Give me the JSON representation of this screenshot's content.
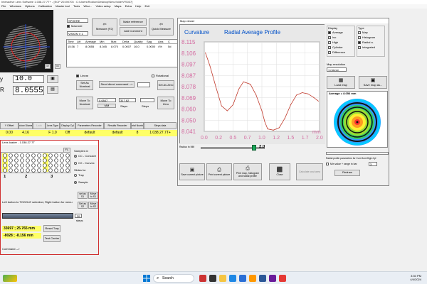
{
  "app": {
    "title": "Interactive Lens Software 1.038.27.7T+ - [ECP 20190703 : C:\\Users\\Rodion\\Desktop\\New folder\\FS037]",
    "menu": [
      "File",
      "Windows",
      "Options",
      "Calibration",
      "Master tool",
      "Tools",
      "Wizz...",
      "Video setup",
      "Maps",
      "Extra",
      "Help",
      "Exit"
    ]
  },
  "main": {
    "readout_label_1": "y",
    "readout_value_1": "10.0",
    "readout_label_2": "R",
    "readout_value_2": "8.0555",
    "cam_btn_1": "Rf",
    "cam_btn_2": "Ch",
    "lens_select_1": "SPHERE",
    "lens_select_2": "VISION V 1",
    "checkbox_macrode": "Macrode",
    "btn_measure": "Measure (F2)",
    "btn_make_reference": "Make reference",
    "btn_add_comment": "Add Comment",
    "btn_quick_measure": "Quick Measure",
    "table_headers": [
      "Time",
      "Lift",
      "Average",
      "Min",
      "Max",
      "Delta",
      "Quality",
      "Sag",
      "Axis",
      "C"
    ],
    "table_row": [
      "15:36",
      "7",
      "8.0555",
      "8.045",
      "8.070",
      "0.0007",
      "16.0",
      "0.0000",
      "4%",
      "5d"
    ],
    "checkbox_linear": "Linear",
    "checkbox_rotational": "Rotational",
    "btn_set_as_nominal": "Set As Nominal",
    "btn_send_direct": "Send direct command -->",
    "btn_set_as_zero": "Set As Zero",
    "btn_move_to_nominal": "Move To Nominal",
    "pos_value": "0.0847",
    "pos_value_2": "317.62",
    "pos_unit_1": "MM",
    "pos_unit_2": "Steps",
    "pos_unit_3": "Steps",
    "btn_move_to_zero": "Move To Zero",
    "bottom_headers": [
      "Y Offset",
      "Window Diameter",
      "Lock",
      "Lens Type",
      "Display Cyl",
      "Parameters Recorder",
      "Results Recorder",
      "Serial Number",
      "Steps data"
    ],
    "bottom_values": [
      "0.00",
      "4.16",
      "",
      "F 1.0",
      "Off",
      "default",
      "default",
      "8",
      "1.038.27.7T+"
    ]
  },
  "loader": {
    "title": "Lens loader - 1.038.27.7T",
    "sample_label": "Samples in",
    "radio_cc": "CC - Concave",
    "radio_cx": "CX - Convex",
    "slides_label": "Slides for",
    "radio_tray": "Tray",
    "radio_sample": "Sample",
    "columns": [
      "1",
      "2",
      "3"
    ],
    "hint": "Left button to TOGGLE selection; Right button for menu",
    "field_1": "33697 ; 25.765 mm",
    "field_2": "-8028 ; -8.156 mm",
    "btn_reset_tray": "Reset Tray",
    "btn_test_center": "Test Center",
    "steps_value": "20",
    "steps_label": "steps",
    "btn_set_as_s1": "set as S1",
    "btn_move_to_s1": "Move to S1",
    "btn_set_as_s2": "Set as S2",
    "btn_move_to_s2": "Move to S2",
    "cmd_label": "Command -->"
  },
  "map_viewer": {
    "title": "Map viewer",
    "chart_label_left": "Curvature",
    "chart_label_center": "Radial Average Profile",
    "display_label": "Display",
    "display_options": [
      {
        "label": "Average",
        "checked": true
      },
      {
        "label": "Iso",
        "checked": false
      },
      {
        "label": "Hlgh",
        "checked": false
      },
      {
        "label": "Cylinder",
        "checked": false
      },
      {
        "label": "Difference",
        "checked": false
      }
    ],
    "type_label": "Type",
    "type_options": [
      {
        "label": "Map",
        "checked": false
      },
      {
        "label": "Histogram",
        "checked": false
      },
      {
        "label": "Radial a.",
        "checked": true
      },
      {
        "label": "Integrated",
        "checked": false
      }
    ],
    "map_resolution_label": "Map resolution",
    "map_resolution_value": "1 micron",
    "btn_load_map": "Load map",
    "btn_save_map": "Save map as...",
    "average_readout": "Average = 8.056 mm",
    "radius_label": "Radius in MM",
    "radius_value": "2.0",
    "btn_save_current_picture": "Save current picture",
    "btn_print_current_picture": "Print current picture",
    "btn_print_map": "Print map, histogram and radial profile",
    "btn_close": "Close",
    "btn_calculate_cust": "Calculate cust area",
    "radial_params_label": "Radial profile parameters for Curr-Sum/High-Cyl",
    "checkbox_min_value": "Min value + range in bar",
    "min_value_field": "3",
    "btn_redraw": "Redraw"
  },
  "chart_data": {
    "type": "line",
    "title": "Radial Average Profile",
    "ylabel": "Curvature",
    "xlabel": "mm",
    "xlim": [
      0,
      2.0
    ],
    "ylim": [
      8.041,
      8.115
    ],
    "x_ticks": [
      "0.0",
      "0.2",
      "0.5",
      "0.7",
      "1.0",
      "1.2",
      "1.5",
      "1.7",
      "2.0"
    ],
    "y_ticks": [
      "8.115",
      "8.106",
      "8.097",
      "8.087",
      "8.078",
      "8.069",
      "8.060",
      "8.050",
      "8.041"
    ],
    "grid": true,
    "color": "#c0392b",
    "series": [
      {
        "x": [
          0.02,
          0.1,
          0.2,
          0.3,
          0.4,
          0.5,
          0.6,
          0.68,
          0.8,
          0.9,
          1.0,
          1.05,
          1.1,
          1.2,
          1.3,
          1.4,
          1.5,
          1.6,
          1.7,
          1.8,
          1.9,
          1.98
        ],
        "y": [
          8.106,
          8.095,
          8.078,
          8.062,
          8.058,
          8.063,
          8.076,
          8.082,
          8.08,
          8.071,
          8.058,
          8.049,
          8.043,
          8.042,
          8.044,
          8.052,
          8.063,
          8.071,
          8.073,
          8.072,
          8.069,
          8.066
        ]
      }
    ]
  },
  "taskbar": {
    "search_placeholder": "Search",
    "time": "3:30 PM",
    "date": "4/4/2024"
  },
  "colors": {
    "yellow_row": "#ffff66",
    "chart_line": "#c0392b",
    "accent_title": "#0050c8",
    "tick_pink": "#d46aa0",
    "loader_border": "#d03030"
  }
}
